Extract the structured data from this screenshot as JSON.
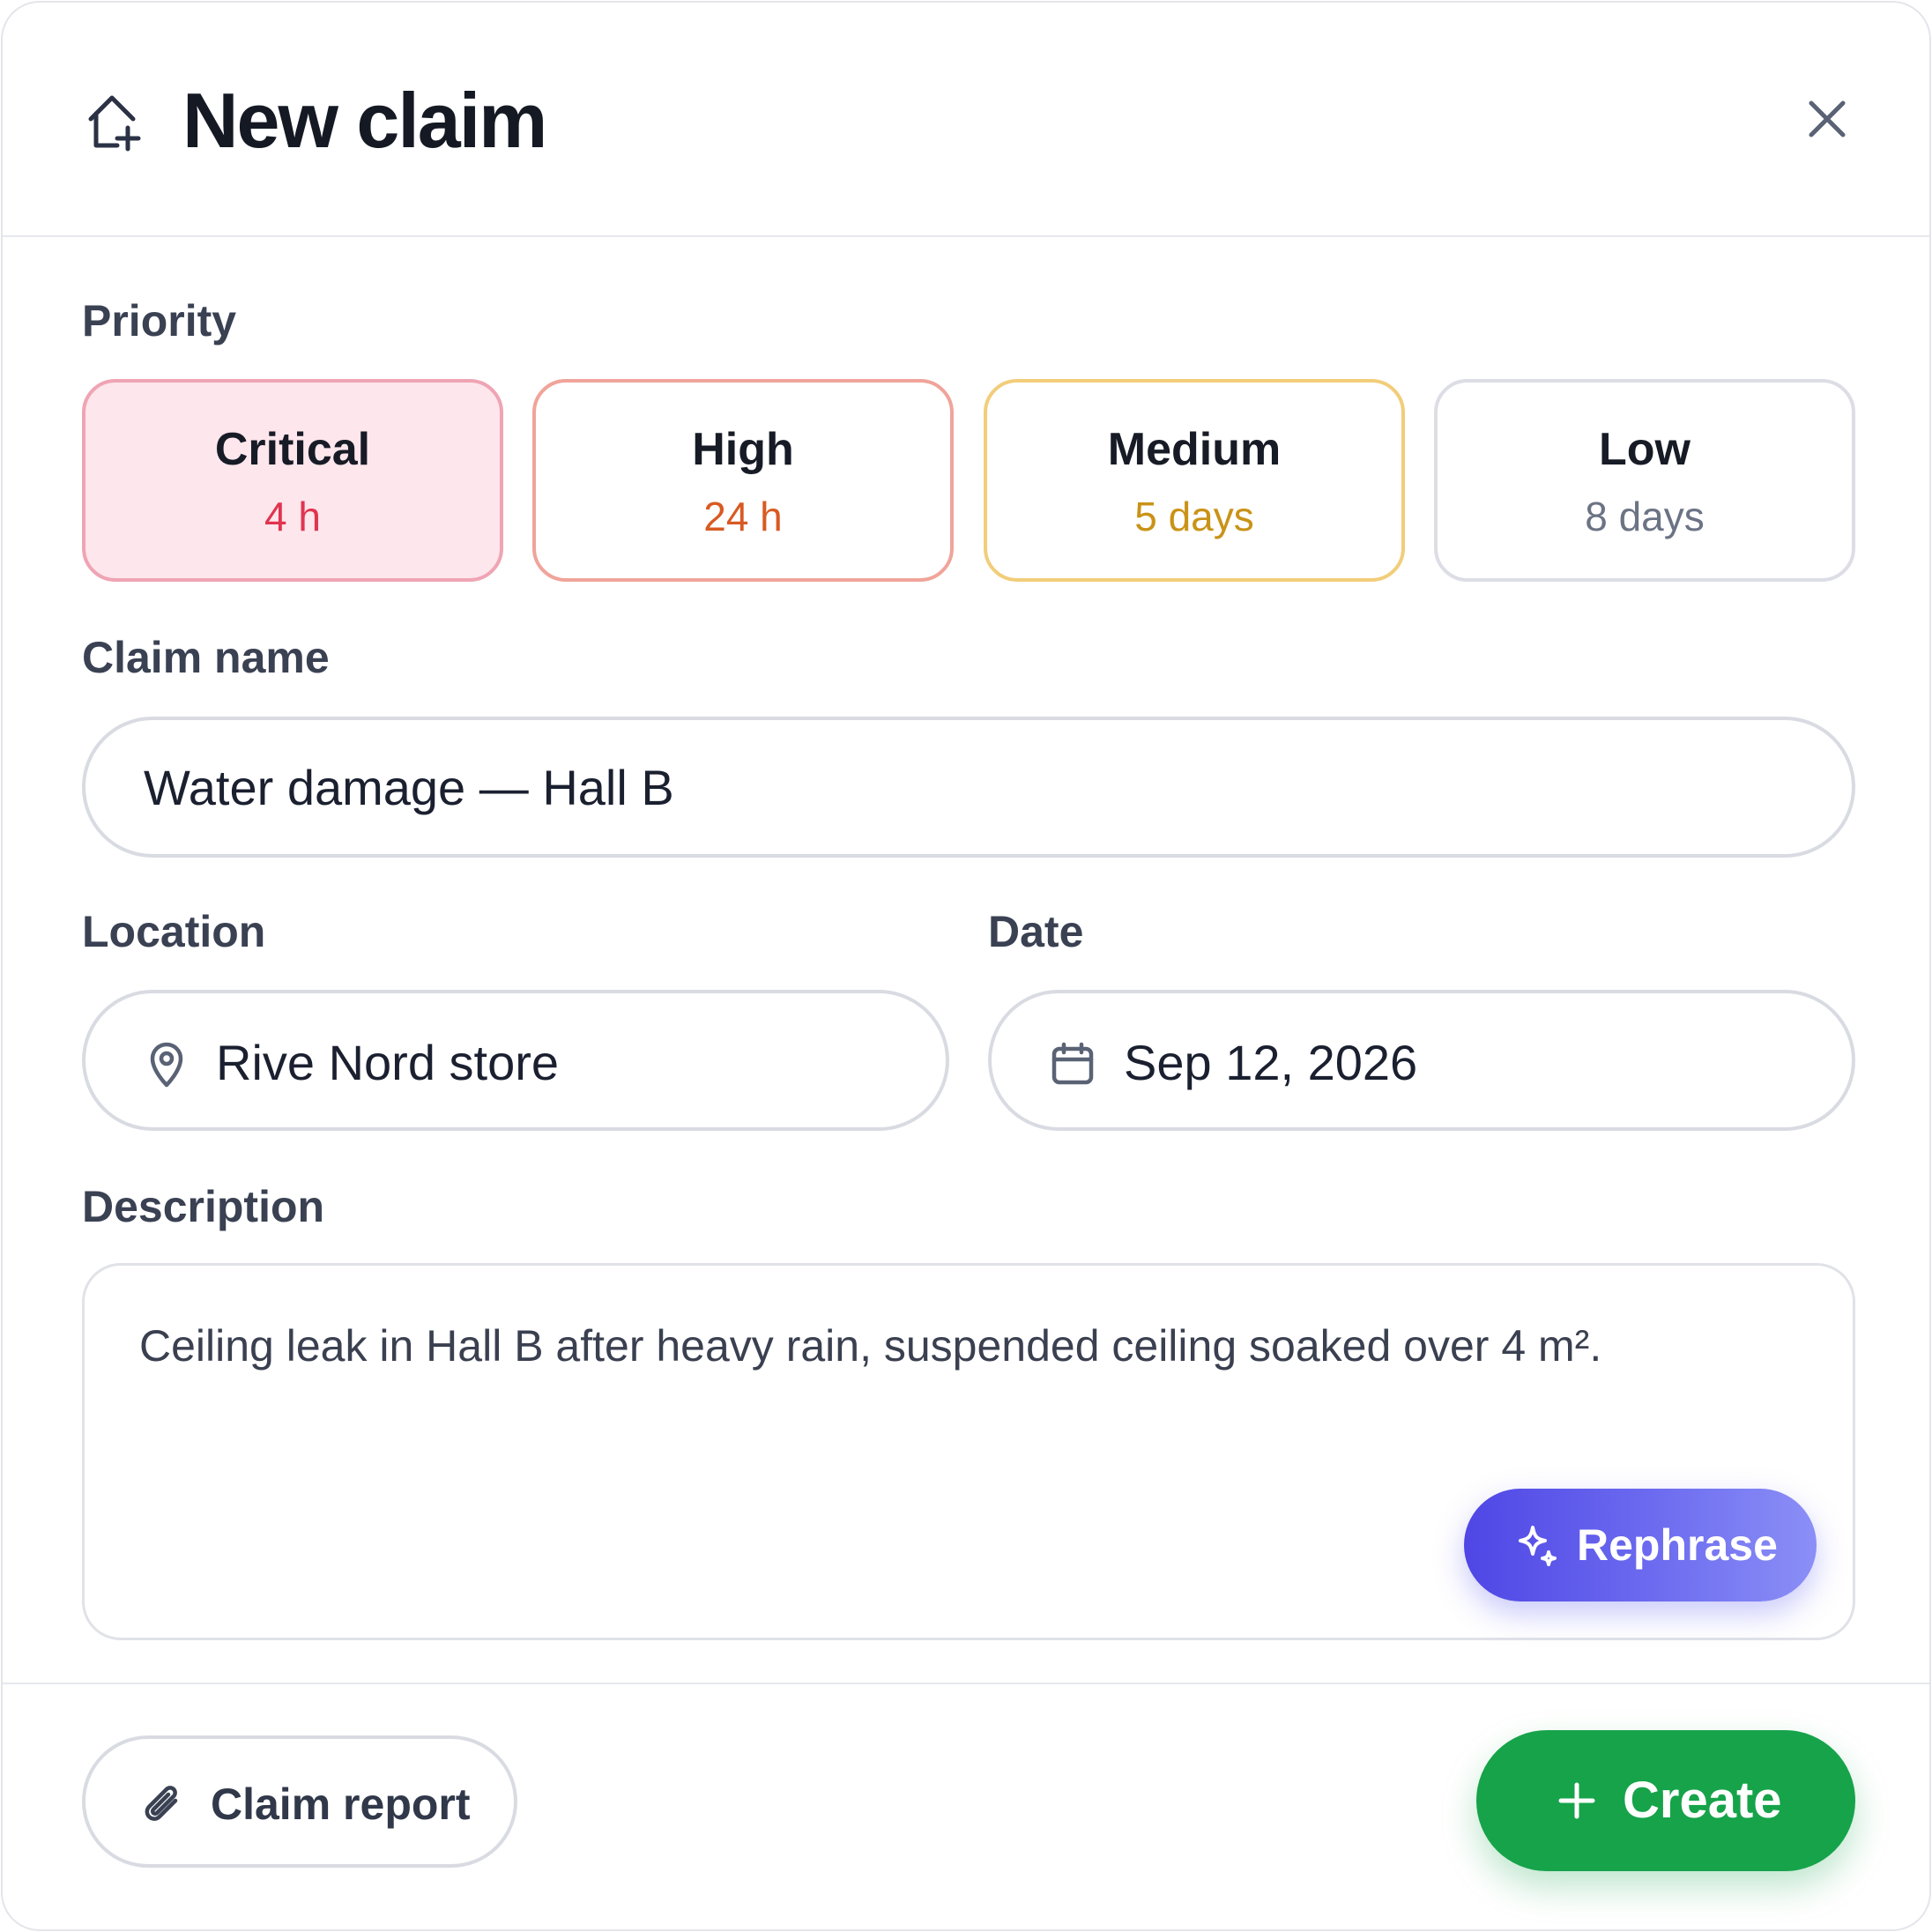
{
  "header": {
    "icon": "house-plus-icon",
    "title": "New claim",
    "close_icon": "close-icon"
  },
  "priority": {
    "label": "Priority",
    "selected": "Critical",
    "options": [
      {
        "name": "Critical",
        "time": "4 h",
        "color": "#e0344f"
      },
      {
        "name": "High",
        "time": "24 h",
        "color": "#d85a22"
      },
      {
        "name": "Medium",
        "time": "5 days",
        "color": "#c99317"
      },
      {
        "name": "Low",
        "time": "8 days",
        "color": "#6b7385"
      }
    ]
  },
  "claim_name": {
    "label": "Claim name",
    "value": "Water damage — Hall B"
  },
  "location": {
    "label": "Location",
    "icon": "map-pin-icon",
    "value": "Rive Nord store"
  },
  "date": {
    "label": "Date",
    "icon": "calendar-icon",
    "value": "Sep 12, 2026"
  },
  "description": {
    "label": "Description",
    "value": "Ceiling leak in Hall B after heavy rain, suspended ceiling soaked over 4 m².",
    "rephrase_label": "Rephrase",
    "rephrase_icon": "sparkles-icon"
  },
  "footer": {
    "attach_label": "Claim report",
    "attach_icon": "paperclip-icon",
    "create_label": "Create",
    "create_icon": "plus-icon"
  },
  "colors": {
    "accent_create": "#16a34a",
    "accent_rephrase": "#4f46e5"
  }
}
